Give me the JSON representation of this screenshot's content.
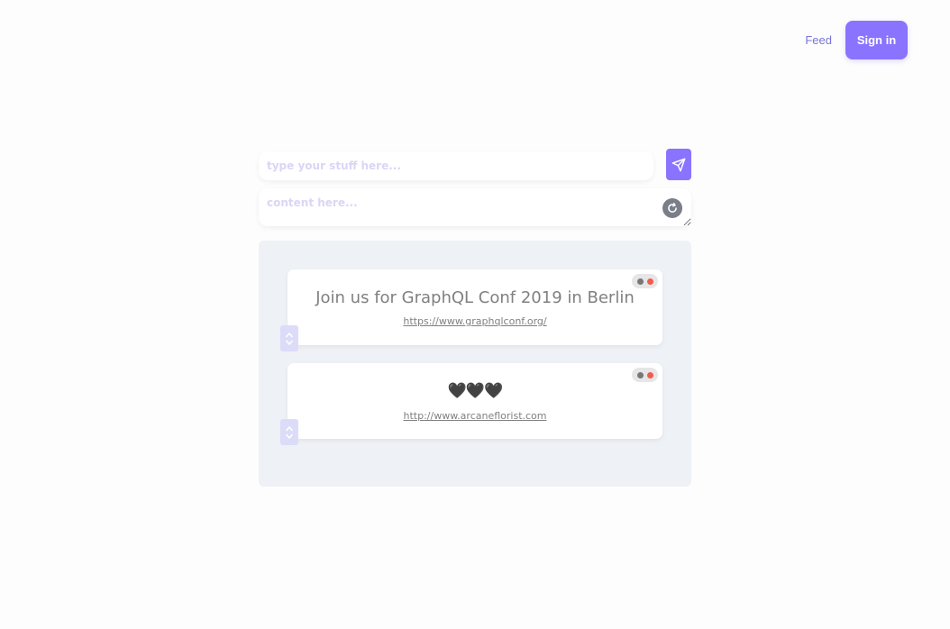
{
  "nav": {
    "feed_label": "Feed",
    "signin_label": "Sign in"
  },
  "composer": {
    "title_placeholder": "type your stuff here...",
    "content_placeholder": "content here...",
    "send_icon": "paper-plane-icon",
    "refresh_icon": "refresh-icon"
  },
  "posts": [
    {
      "title": "Join us for GraphQL Conf 2019 in Berlin",
      "url": "https://www.graphqlconf.org/"
    },
    {
      "title": "🖤🖤🖤",
      "url": "http://www.arcaneflorist.com"
    }
  ],
  "colors": {
    "accent": "#8a73ff",
    "feed_link": "#7a74d6",
    "panel_bg": "#eef1f5",
    "vote_bg": "#dcdcf9",
    "dot_red": "#f25a4a",
    "dot_grey": "#777777"
  }
}
